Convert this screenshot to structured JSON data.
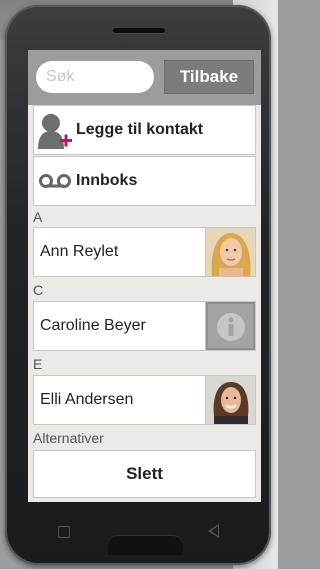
{
  "search": {
    "placeholder": "Søk"
  },
  "toolbar": {
    "back_label": "Tilbake"
  },
  "actions": {
    "add_contact_label": "Legge til kontakt",
    "inbox_label": "Innboks"
  },
  "sections": [
    {
      "letter": "A",
      "contacts": [
        {
          "name": "Ann Reylet",
          "avatar": "woman-blonde-photo"
        }
      ]
    },
    {
      "letter": "C",
      "contacts": [
        {
          "name": "Caroline Beyer",
          "avatar": "info-placeholder-icon"
        }
      ]
    },
    {
      "letter": "E",
      "contacts": [
        {
          "name": "Elli Andersen",
          "avatar": "woman-dark-hair-photo"
        }
      ]
    }
  ],
  "options": {
    "header": "Alternativer",
    "delete_label": "Slett"
  },
  "colors": {
    "searchbar_bg": "#9b9c9e",
    "back_button_bg": "#7b7c7e",
    "add_accent": "#c2185b",
    "list_bg": "#eceae6"
  }
}
